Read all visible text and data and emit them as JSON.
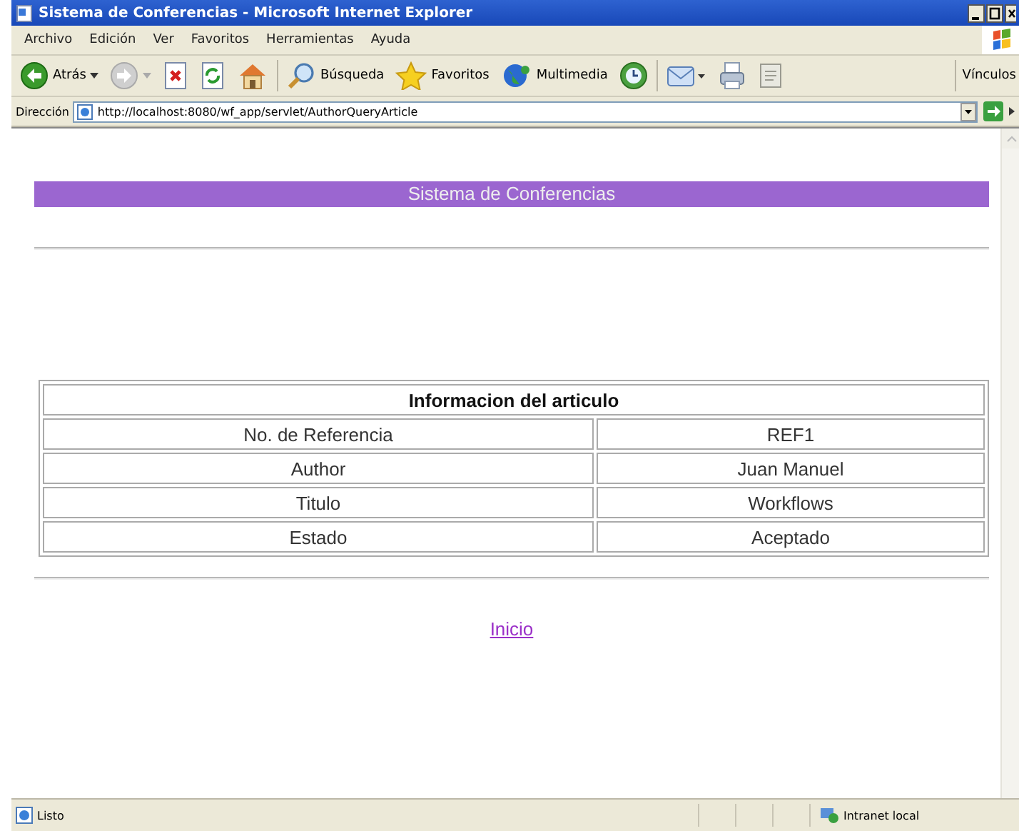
{
  "window": {
    "title": "Sistema de Conferencias - Microsoft Internet Explorer"
  },
  "menu": [
    "Archivo",
    "Edición",
    "Ver",
    "Favoritos",
    "Herramientas",
    "Ayuda"
  ],
  "toolbar": [
    {
      "kind": "back",
      "label": "Atrás"
    },
    {
      "kind": "forward"
    },
    {
      "kind": "stop"
    },
    {
      "kind": "refresh"
    },
    {
      "kind": "home"
    },
    {
      "kind": "search",
      "label": "Búsqueda"
    },
    {
      "kind": "favorites",
      "label": "Favoritos"
    },
    {
      "kind": "media",
      "label": "Multimedia"
    },
    {
      "kind": "history"
    },
    {
      "kind": "mail"
    },
    {
      "kind": "print"
    },
    {
      "kind": "edit"
    }
  ],
  "links_label": "Vínculos",
  "address": {
    "label": "Dirección",
    "value": "http://localhost:8080/wf_app/servlet/AuthorQueryArticle"
  },
  "page": {
    "banner": "Sistema de Conferencias",
    "table": {
      "heading": "Informacion del articulo",
      "rows": [
        [
          "No. de Referencia",
          "REF1"
        ],
        [
          "Author",
          "Juan Manuel"
        ],
        [
          "Titulo",
          "Workflows"
        ],
        [
          "Estado",
          "Aceptado"
        ]
      ]
    },
    "link": "Inicio"
  },
  "status_bar": {
    "text": "Listo",
    "zone": "Intranet local"
  }
}
